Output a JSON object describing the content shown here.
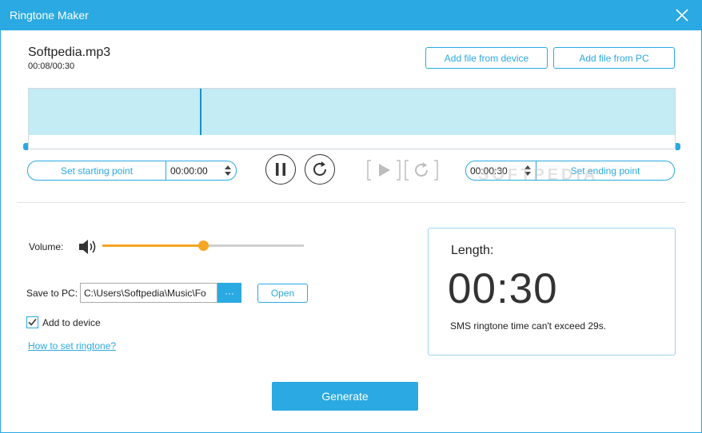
{
  "window": {
    "title": "Ringtone Maker",
    "accent_color": "#2ba9e2",
    "close_icon": "close-icon"
  },
  "file": {
    "name": "Softpedia.mp3",
    "time": "00:08/00:30"
  },
  "buttons": {
    "add_device": "Add file from device",
    "add_pc": "Add file from PC",
    "set_start": "Set starting point",
    "set_end": "Set ending point",
    "open": "Open",
    "browse": "···",
    "generate": "Generate"
  },
  "trim": {
    "start_time": "00:00:00",
    "end_time": "00:00:30",
    "progress_fraction": 0.27
  },
  "watermark": "SOFTPEDIA",
  "volume": {
    "label": "Volume:",
    "level_fraction": 0.5,
    "slider_color": "#f5a623"
  },
  "save": {
    "label": "Save to PC:",
    "path": "C:\\Users\\Softpedia\\Music\\Fo"
  },
  "device": {
    "label": "Add to device",
    "checked": true
  },
  "link": {
    "label": "How to set ringtone?"
  },
  "length": {
    "title": "Length:",
    "value": "00:30",
    "note": "SMS ringtone time can't exceed 29s."
  }
}
